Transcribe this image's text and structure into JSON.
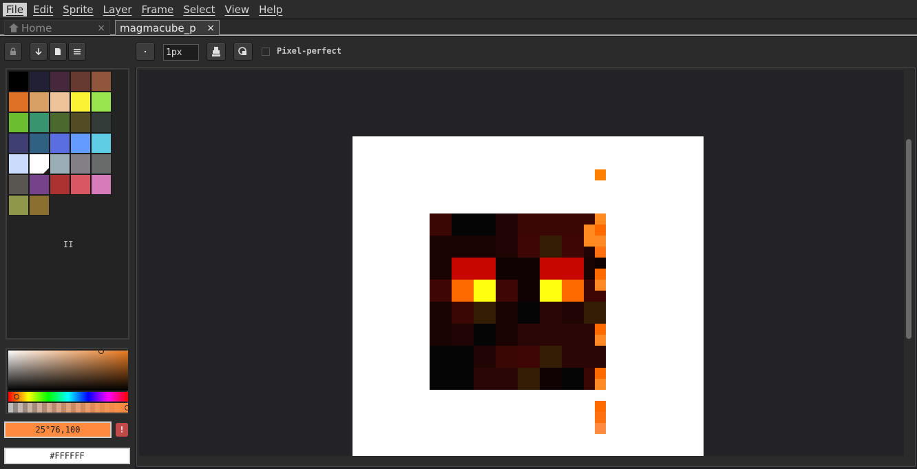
{
  "menu": [
    {
      "label": "File",
      "active": true
    },
    {
      "label": "Edit"
    },
    {
      "label": "Sprite"
    },
    {
      "label": "Layer"
    },
    {
      "label": "Frame"
    },
    {
      "label": "Select"
    },
    {
      "label": "View"
    },
    {
      "label": "Help"
    }
  ],
  "tabs": {
    "home": {
      "label": "Home",
      "close": "×"
    },
    "file": {
      "label": "magmacube_p",
      "close": "×"
    }
  },
  "context": {
    "brush_size": "1px",
    "pixel_perfect_label": "Pixel-perfect",
    "pixel_perfect_checked": false
  },
  "palette": {
    "colors": [
      "#000000",
      "#222034",
      "#45283c",
      "#663931",
      "#8f563b",
      "#df7126",
      "#d9a066",
      "#eec39a",
      "#fbf236",
      "#99e550",
      "#6abe30",
      "#37946e",
      "#4b692f",
      "#524b24",
      "#323c39",
      "#3f3f74",
      "#306082",
      "#5b6ee1",
      "#639bff",
      "#5fcde4",
      "#cbdbfc",
      "#ffffff",
      "#9badb7",
      "#847e87",
      "#696a6a",
      "#595652",
      "#76428a",
      "#ac3232",
      "#d95763",
      "#d77bba",
      "#8f974a",
      "#8a6f30"
    ],
    "selected_index": 21,
    "more_indicator": "II"
  },
  "color_bar": {
    "foreground_value": "25°76,100",
    "foreground_hex": "#ff8a40",
    "background_value": "#FFFFFF",
    "warning_icon": "!"
  }
}
